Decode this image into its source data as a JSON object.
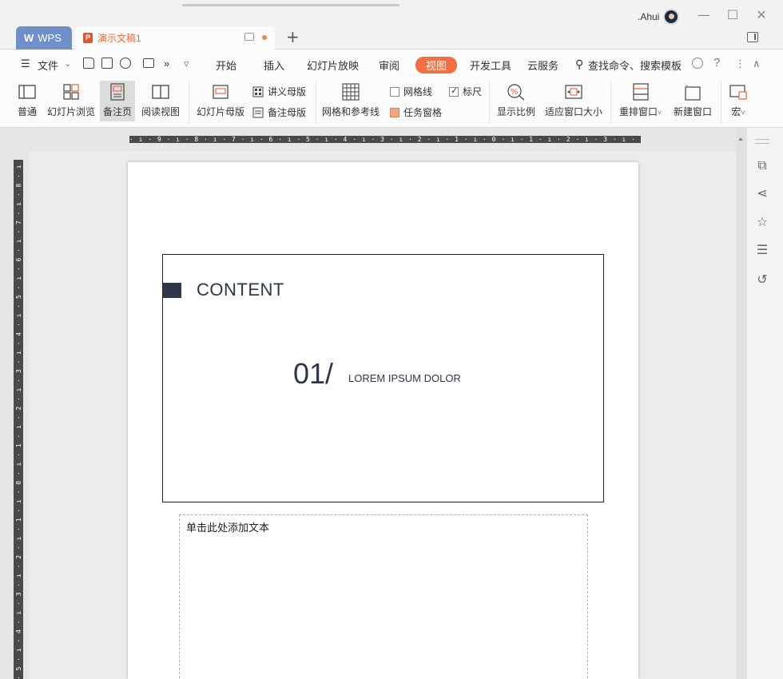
{
  "titlebar": {
    "user_name": ".Ahui",
    "wps_tab_label": "WPS",
    "doc_tab_label": "演示文稿1",
    "doc_icon_letter": "P",
    "add_tab": "+",
    "minimize": "—",
    "maximize": "☐",
    "close": "✕"
  },
  "menu": {
    "hamburger": "☰",
    "file_label": "文件",
    "file_chevron": "⌄",
    "more": "»",
    "dropdown": "▿",
    "items": [
      "开始",
      "插入",
      "幻灯片放映",
      "审阅",
      "视图",
      "开发工具",
      "云服务"
    ],
    "active_item": "视图",
    "search_icon": "⚲",
    "search_label": "查找命令、搜索模板",
    "help": "?",
    "more_vert": "⋮",
    "collapse": "∧"
  },
  "ribbon": {
    "normal": "普通",
    "slide_browse": "幻灯片浏览",
    "notes_page": "备注页",
    "reading_view": "阅读视图",
    "slide_master": "幻灯片母版",
    "handout_master": "讲义母版",
    "notes_master": "备注母版",
    "grid_guides": "网格和参考线",
    "gridlines": "网格线",
    "ruler": "标尺",
    "task_pane": "任务窗格",
    "zoom": "显示比例",
    "fit_window": "适应窗口大小",
    "arrange_windows": "重排窗口",
    "new_window": "新建窗口",
    "macro": "宏",
    "caret": "˅",
    "gridlines_checked": false,
    "ruler_checked": true,
    "task_pane_checked": true
  },
  "rulers": {
    "horizontal": "· ı · 9 · ı · 8 · ı · 7 · ı · 6 · ı · 5 · ı · 4 · ı · 3 · ı · 2 · ı · 1 · ı · 0 · ı · 1 · ı · 2 · ı · 3 · ı · 4 · ı · 5 · ı · 6 · ı · 7 · ı · 8 · ı · 9 · ı ·",
    "vertical": "· 5 · ı · 4 · ı · 3 · ı · 2 · ı · 1 · ı · 0 · ı · 1 · ı · 2 · ı · 3 · ı · 4 · ı · 5 · ı · 6 · ı · 7 · ı · 8 · ı · 9 · ı · 10 · ı · 11 · ı · 12 · ı · 13 · ı · 1"
  },
  "slide": {
    "title": "CONTENT",
    "number": "01/",
    "subtitle": "LOREM IPSUM DOLOR"
  },
  "notes": {
    "placeholder": "单击此处添加文本"
  },
  "sidepanel": {
    "icons": [
      "⧉",
      "⋖",
      "☆",
      "☰",
      "↺"
    ]
  },
  "colors": {
    "accent": "#ee7043",
    "wps_tab": "#6f8fc9",
    "slide_dark": "#2e3648"
  }
}
